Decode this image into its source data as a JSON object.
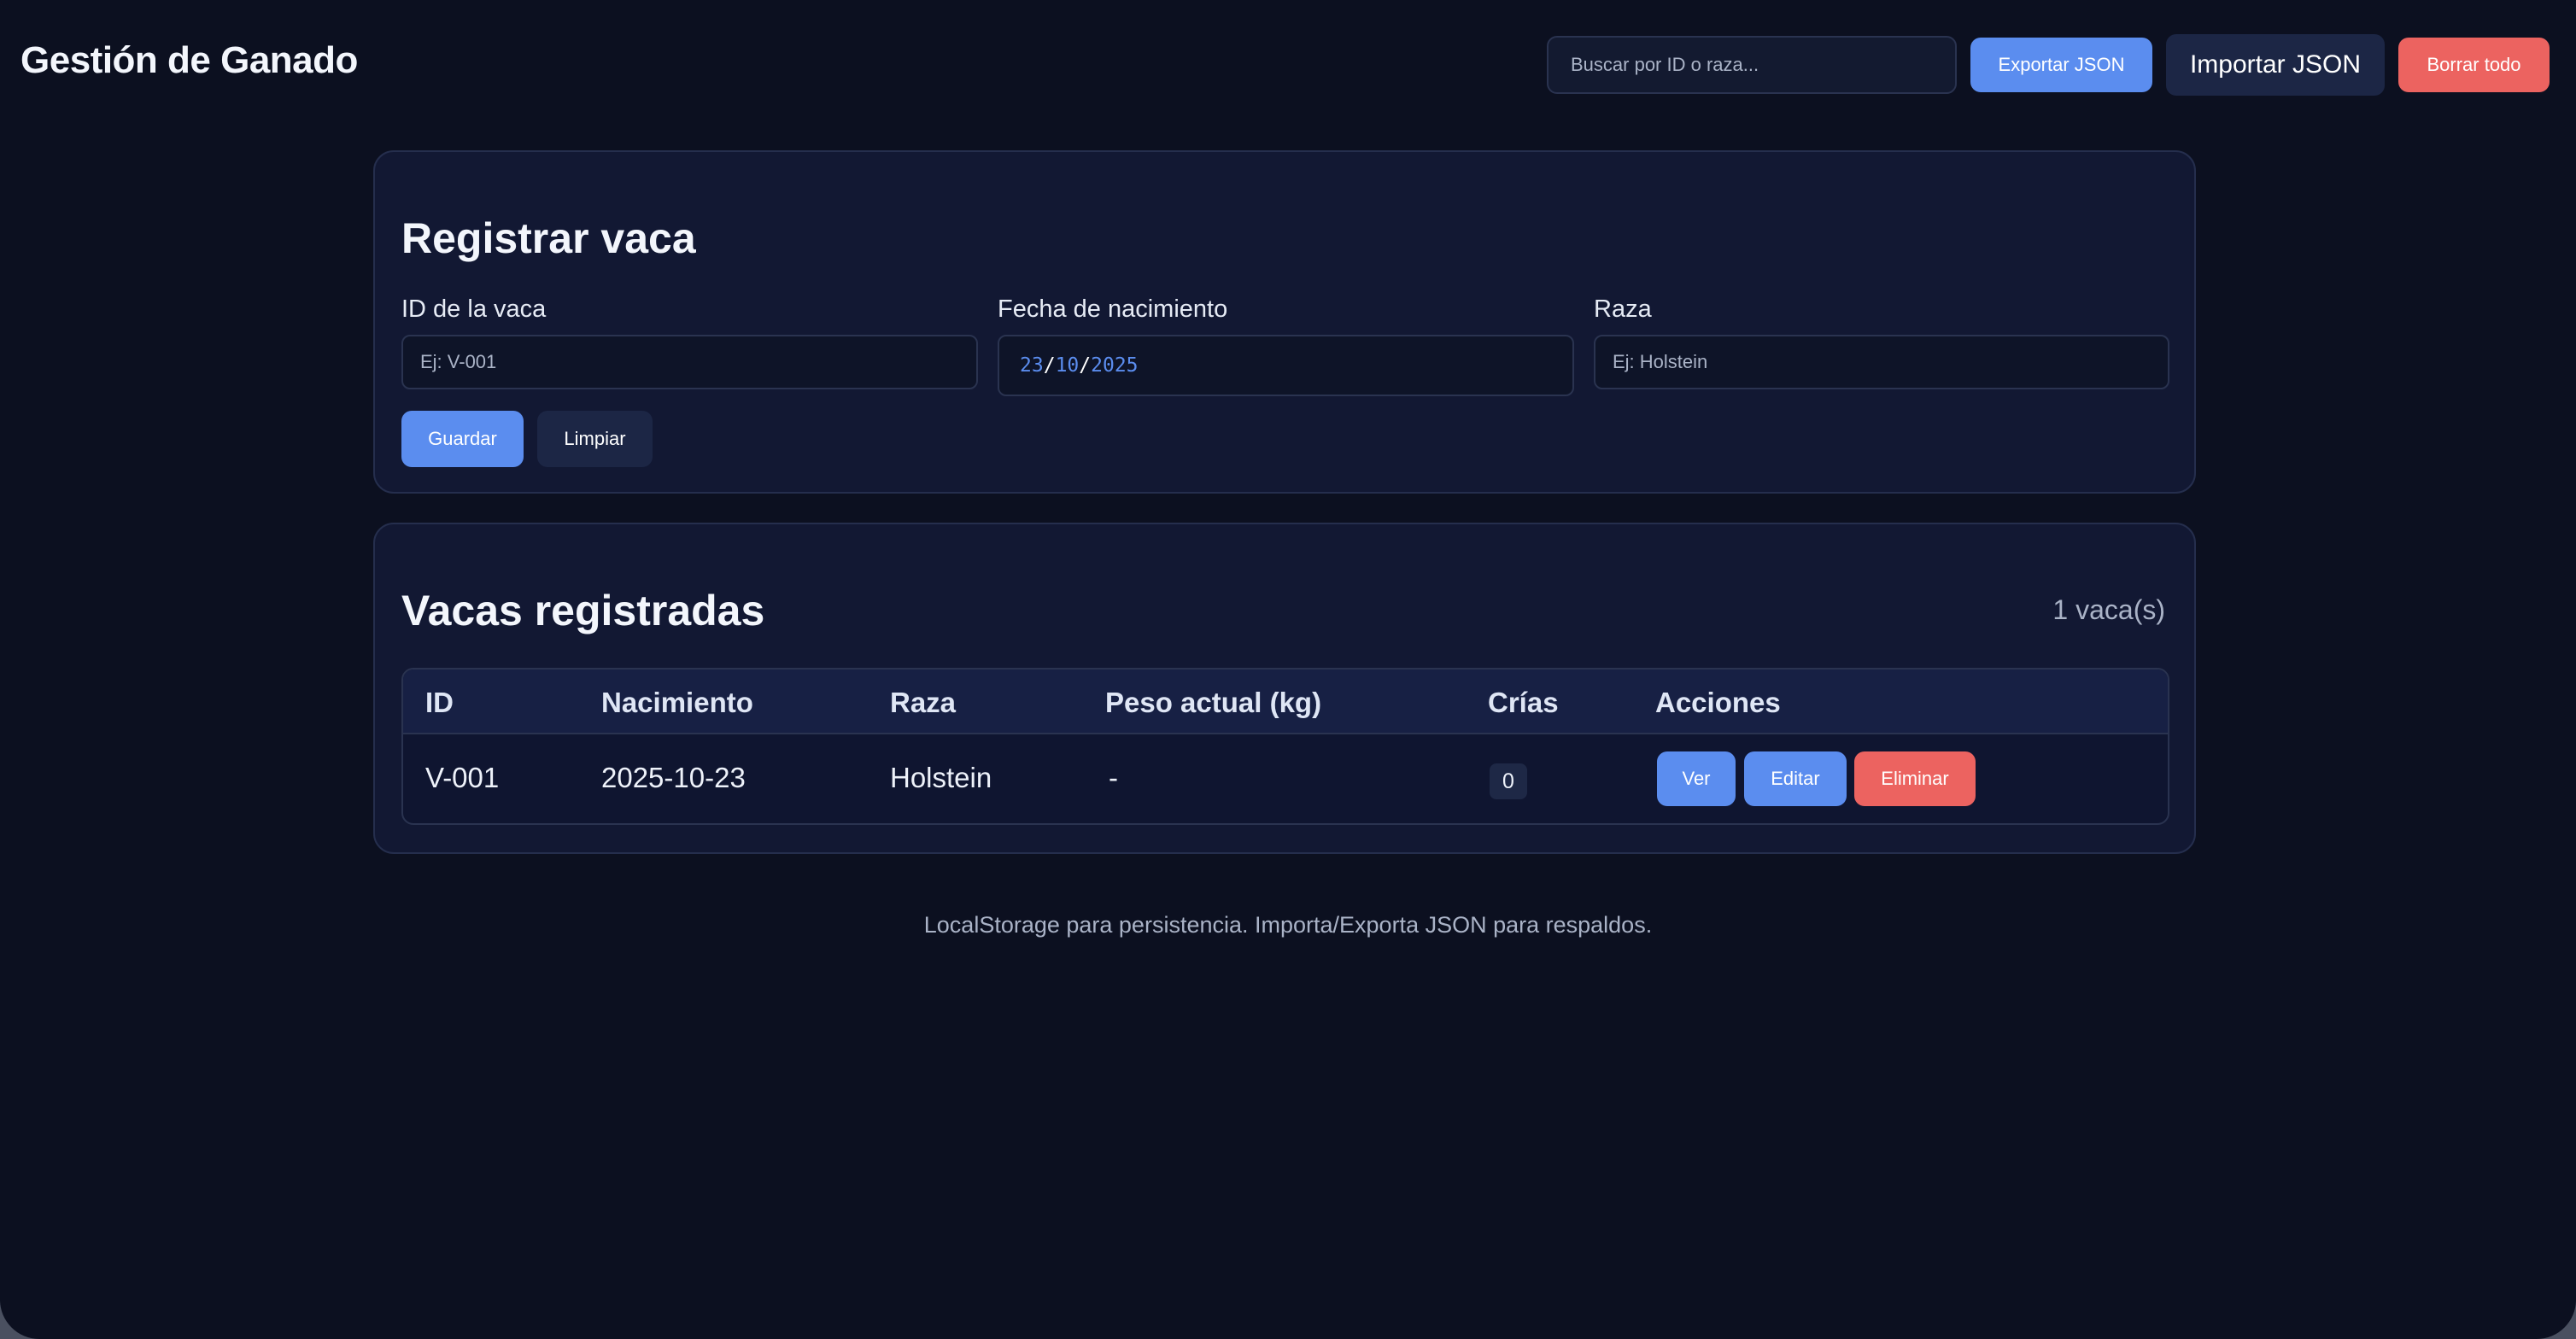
{
  "header": {
    "title": "Gestión de Ganado",
    "search_placeholder": "Buscar por ID o raza...",
    "export_label": "Exportar JSON",
    "import_label": "Importar JSON",
    "clear_all_label": "Borrar todo"
  },
  "form": {
    "title": "Registrar vaca",
    "id_label": "ID de la vaca",
    "id_placeholder": "Ej: V-001",
    "date_label": "Fecha de nacimiento",
    "date_day": "23",
    "date_month": "10",
    "date_year": "2025",
    "date_sep": "/",
    "breed_label": "Raza",
    "breed_placeholder": "Ej: Holstein",
    "save_label": "Guardar",
    "reset_label": "Limpiar"
  },
  "list": {
    "title": "Vacas registradas",
    "count": "1 vaca(s)",
    "columns": [
      "ID",
      "Nacimiento",
      "Raza",
      "Peso actual (kg)",
      "Crías",
      "Acciones"
    ],
    "rows": [
      {
        "id": "V-001",
        "birth": "2025-10-23",
        "breed": "Holstein",
        "weight": "-",
        "calves": "0",
        "actions": {
          "view": "Ver",
          "edit": "Editar",
          "delete": "Eliminar"
        }
      }
    ]
  },
  "footer": {
    "text": "LocalStorage para persistencia. Importa/Exporta JSON para respaldos."
  },
  "colors": {
    "background": "#0c1020",
    "card": "#121833",
    "primary": "#5b8def",
    "danger": "#ec6360",
    "dark_button": "#1c2645"
  }
}
